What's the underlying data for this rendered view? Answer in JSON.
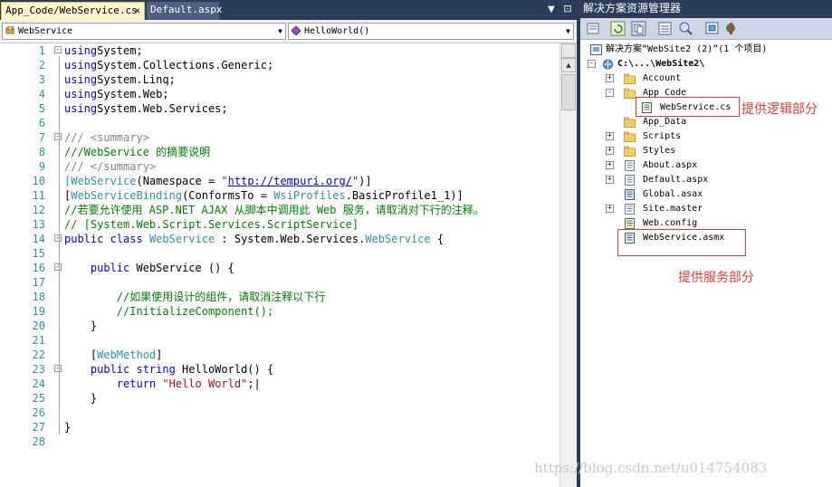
{
  "editor": {
    "tabs": [
      {
        "label": "App_Code/WebService.cs",
        "close": "×"
      },
      {
        "label": "Default.aspx"
      }
    ],
    "tab_menu_glyph": "▼",
    "tab_pin_glyph": "⊡",
    "type_combo": "WebService",
    "member_combo": "HelloWorld()",
    "combo_arrow": "▼",
    "scroll_up": "▲",
    "lines": [
      {
        "n": "1",
        "fold": "-",
        "parts": [
          [
            "k",
            "using"
          ],
          [
            "",
            "System;"
          ]
        ]
      },
      {
        "n": "2",
        "parts": [
          [
            "k",
            "using"
          ],
          [
            "",
            "System.Collections.Generic;"
          ]
        ]
      },
      {
        "n": "3",
        "parts": [
          [
            "k",
            "using"
          ],
          [
            "",
            "System.Linq;"
          ]
        ]
      },
      {
        "n": "4",
        "parts": [
          [
            "k",
            "using"
          ],
          [
            "",
            "System.Web;"
          ]
        ]
      },
      {
        "n": "5",
        "parts": [
          [
            "k",
            "using"
          ],
          [
            "",
            "System.Web.Services;"
          ]
        ]
      },
      {
        "n": "6",
        "parts": []
      },
      {
        "n": "7",
        "fold": "-",
        "parts": [
          [
            "g",
            "/// <summary>"
          ]
        ]
      },
      {
        "n": "8",
        "parts": [
          [
            "c",
            "///WebService 的摘要说明"
          ]
        ]
      },
      {
        "n": "9",
        "parts": [
          [
            "g",
            "/// </summary>"
          ]
        ]
      },
      {
        "n": "10",
        "parts": [
          [
            "",
            ""
          ],
          [
            "t",
            "[WebService"
          ],
          [
            "",
            "(Namespace = "
          ],
          [
            "s",
            "\""
          ],
          [
            "u",
            "http://tempuri.org/"
          ],
          [
            "s",
            "\""
          ],
          [
            "",
            ")]"
          ]
        ]
      },
      {
        "n": "11",
        "parts": [
          [
            "",
            ""
          ],
          [
            "",
            "["
          ],
          [
            "t",
            "WebServiceBinding"
          ],
          [
            "",
            "(ConformsTo = "
          ],
          [
            "t",
            "WsiProfiles"
          ],
          [
            "",
            ".BasicProfile1_1)]"
          ]
        ]
      },
      {
        "n": "12",
        "parts": [
          [
            "c",
            "//若要允许使用 ASP.NET AJAX 从脚本中调用此 Web 服务，请取消对下行的注释。"
          ]
        ]
      },
      {
        "n": "13",
        "parts": [
          [
            "c",
            "// [System.Web.Script.Services.ScriptService]"
          ]
        ]
      },
      {
        "n": "14",
        "fold": "-",
        "parts": [
          [
            "k",
            "public class"
          ],
          [
            "",
            " "
          ],
          [
            "t",
            "WebService"
          ],
          [
            "",
            " : System.Web.Services."
          ],
          [
            "t",
            "WebService"
          ],
          [
            "",
            " {"
          ]
        ]
      },
      {
        "n": "15",
        "parts": []
      },
      {
        "n": "16",
        "fold": "-",
        "parts": [
          [
            "",
            "    "
          ],
          [
            "k",
            "public"
          ],
          [
            "",
            " WebService () {"
          ]
        ]
      },
      {
        "n": "17",
        "parts": []
      },
      {
        "n": "18",
        "parts": [
          [
            "c",
            "        //如果使用设计的组件，请取消注释以下行"
          ]
        ]
      },
      {
        "n": "19",
        "parts": [
          [
            "c",
            "        //InitializeComponent();"
          ]
        ]
      },
      {
        "n": "20",
        "parts": [
          [
            "",
            "    }"
          ]
        ]
      },
      {
        "n": "21",
        "parts": []
      },
      {
        "n": "22",
        "parts": [
          [
            "",
            "    ["
          ],
          [
            "t",
            "WebMethod"
          ],
          [
            "",
            "]"
          ]
        ]
      },
      {
        "n": "23",
        "fold": "-",
        "parts": [
          [
            "",
            "    "
          ],
          [
            "k",
            "public string"
          ],
          [
            "",
            " HelloWorld() {"
          ]
        ]
      },
      {
        "n": "24",
        "parts": [
          [
            "",
            "        "
          ],
          [
            "k",
            "return"
          ],
          [
            "",
            " "
          ],
          [
            "s",
            "\"Hello World\""
          ],
          [
            "",
            ";|"
          ]
        ]
      },
      {
        "n": "25",
        "parts": [
          [
            "",
            "    }"
          ]
        ]
      },
      {
        "n": "26",
        "parts": []
      },
      {
        "n": "27",
        "parts": [
          [
            "",
            "}"
          ]
        ]
      },
      {
        "n": "28",
        "parts": []
      }
    ]
  },
  "solution_explorer": {
    "title": "解决方案资源管理器",
    "solution_label": "解决方案“WebSite2 (2)”(1 个项目)",
    "project_label": "C:\\...\\WebSite2\\",
    "items": [
      {
        "label": "Account",
        "type": "folder",
        "exp": "+"
      },
      {
        "label": "App_Code",
        "type": "folder",
        "exp": "-"
      },
      {
        "label": "WebService.cs",
        "type": "cs",
        "child": true
      },
      {
        "label": "App_Data",
        "type": "folder"
      },
      {
        "label": "Scripts",
        "type": "folder",
        "exp": "+"
      },
      {
        "label": "Styles",
        "type": "folder",
        "exp": "+"
      },
      {
        "label": "About.aspx",
        "type": "page",
        "exp": "+"
      },
      {
        "label": "Default.aspx",
        "type": "page",
        "exp": "+"
      },
      {
        "label": "Global.asax",
        "type": "asax"
      },
      {
        "label": "Site.master",
        "type": "page",
        "exp": "+"
      },
      {
        "label": "Web.config",
        "type": "config"
      },
      {
        "label": "WebService.asmx",
        "type": "asmx"
      }
    ],
    "expand_minus": "-"
  },
  "annotations": {
    "logic_label": "提供逻辑部分",
    "service_label": "提供服务部分"
  },
  "watermark": "https://blog.csdn.net/u014754083",
  "colors": {
    "keyword": "#0000ff",
    "type": "#2b91af",
    "comment": "#008000",
    "string": "#a31515",
    "annotation": "#e03c31",
    "chrome": "#2b3c59"
  }
}
